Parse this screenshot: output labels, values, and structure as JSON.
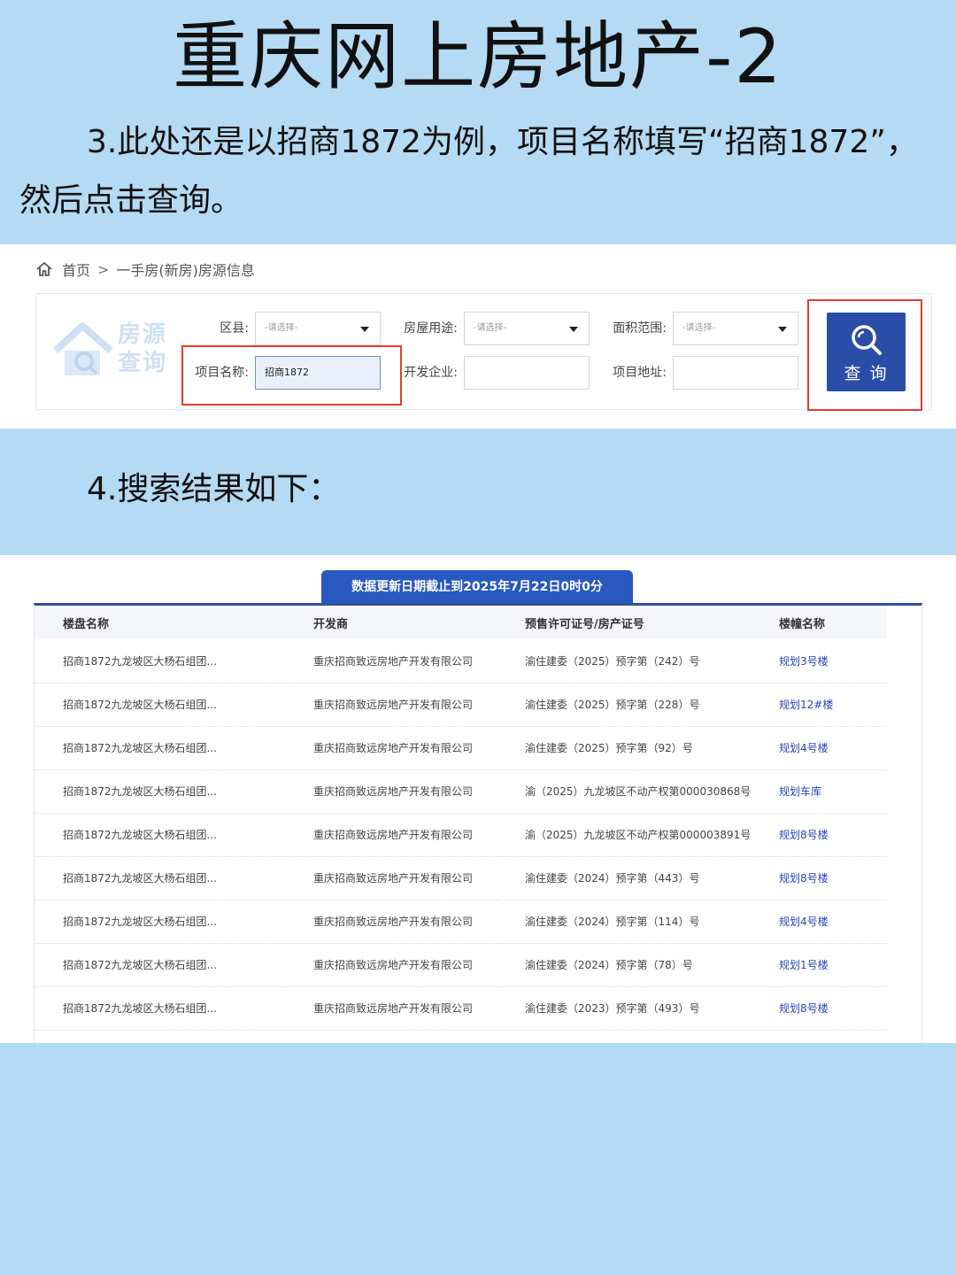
{
  "title": "重庆网上房地产-2",
  "step3": "3.此处还是以招商1872为例，项目名称填写“招商1872”，然后点击查询。",
  "step4": "4.搜索结果如下：",
  "breadcrumb": {
    "home": "首页",
    "separator": ">",
    "current": "一手房(新房)房源信息"
  },
  "search": {
    "logo_text_1": "房源",
    "logo_text_2": "查询",
    "district_label": "区县:",
    "district_value": "-请选择-",
    "usage_label": "房屋用途:",
    "usage_value": "-请选择-",
    "area_label": "面积范围:",
    "area_value": "-请选择-",
    "project_label": "项目名称:",
    "project_value": "招商1872",
    "developer_label": "开发企业:",
    "developer_value": "",
    "address_label": "项目地址:",
    "address_value": "",
    "query_button": "查 询"
  },
  "results": {
    "update_notice": "数据更新日期截止到2025年7月22日0时0分",
    "columns": [
      "楼盘名称",
      "开发商",
      "预售许可证号/房产证号",
      "楼幢名称"
    ],
    "rows": [
      [
        "招商1872九龙坡区大杨石组团...",
        "重庆招商致远房地产开发有限公司",
        "渝住建委（2025）预字第（242）号",
        "规划3号楼"
      ],
      [
        "招商1872九龙坡区大杨石组团...",
        "重庆招商致远房地产开发有限公司",
        "渝住建委（2025）预字第（228）号",
        "规划12#楼"
      ],
      [
        "招商1872九龙坡区大杨石组团...",
        "重庆招商致远房地产开发有限公司",
        "渝住建委（2025）预字第（92）号",
        "规划4号楼"
      ],
      [
        "招商1872九龙坡区大杨石组团...",
        "重庆招商致远房地产开发有限公司",
        "渝（2025）九龙坡区不动产权第000030868号",
        "规划车库"
      ],
      [
        "招商1872九龙坡区大杨石组团...",
        "重庆招商致远房地产开发有限公司",
        "渝（2025）九龙坡区不动产权第000003891号",
        "规划8号楼"
      ],
      [
        "招商1872九龙坡区大杨石组团...",
        "重庆招商致远房地产开发有限公司",
        "渝住建委（2024）预字第（443）号",
        "规划8号楼"
      ],
      [
        "招商1872九龙坡区大杨石组团...",
        "重庆招商致远房地产开发有限公司",
        "渝住建委（2024）预字第（114）号",
        "规划4号楼"
      ],
      [
        "招商1872九龙坡区大杨石组团...",
        "重庆招商致远房地产开发有限公司",
        "渝住建委（2024）预字第（78）号",
        "规划1号楼"
      ],
      [
        "招商1872九龙坡区大杨石组团...",
        "重庆招商致远房地产开发有限公司",
        "渝住建委（2023）预字第（493）号",
        "规划8号楼"
      ]
    ]
  },
  "colors": {
    "background": "#b5daf3",
    "button": "#2a4ea8",
    "highlight": "#e63b32",
    "link": "#2745b8"
  }
}
